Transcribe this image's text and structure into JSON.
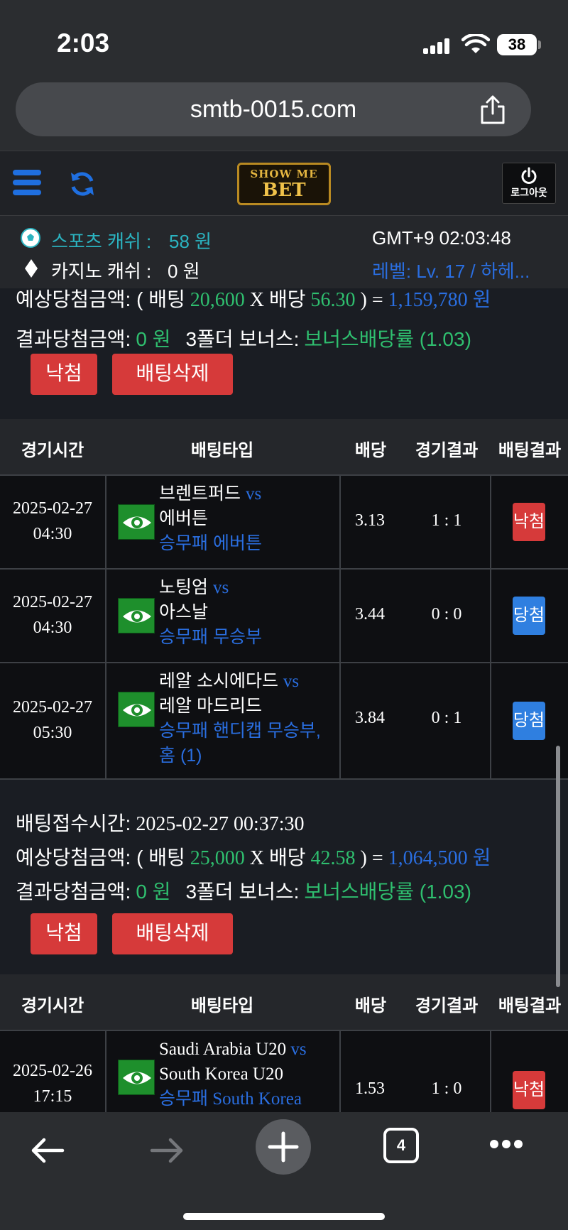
{
  "status_bar": {
    "time": "2:03",
    "battery": "38"
  },
  "browser": {
    "url": "smtb-0015.com",
    "open_tabs": "4"
  },
  "header": {
    "logo_top": "SHOW ME",
    "logo_bottom": "BET",
    "logout_label": "로그아웃"
  },
  "info": {
    "sports_label": "스포츠 캐쉬 :",
    "sports_value": "58 원",
    "casino_label": "카지노 캐쉬 :",
    "casino_value": "0 원",
    "gmt_time": "GMT+9 02:03:48",
    "level": "레벨: Lv. 17 / 하헤..."
  },
  "table_headers": {
    "time": "경기시간",
    "bet_type": "배팅타입",
    "odds": "배당",
    "result": "경기결과",
    "bet_result": "배팅결과"
  },
  "labels": {
    "received_time": "배팅접수시간:",
    "expected": "예상당첨금액: ( 배팅",
    "x_odds": "X 배당",
    "equals": ") =",
    "won": "원",
    "result_amount": "결과당첨금액:",
    "bonus": "3폴더 보너스:",
    "bonus_rate": "보너스배당률 (1.03)",
    "lose_button": "낙첨",
    "delete_button": "배팅삭제",
    "vs": "vs"
  },
  "bet_slips": [
    {
      "received_time": "",
      "stake": "20,600",
      "total_odds": "56.30",
      "expected_payout": "1,159,780",
      "result_amount": "0 원",
      "matches": [
        {
          "date": "2025-02-27",
          "time": "04:30",
          "home": "브렌트퍼드",
          "away": "에버튼",
          "pick": "승무패 에버튼",
          "odds": "3.13",
          "score": "1 : 1",
          "result": "낙첨"
        },
        {
          "date": "2025-02-27",
          "time": "04:30",
          "home": "노팅엄",
          "away": "아스날",
          "pick": "승무패 무승부",
          "odds": "3.44",
          "score": "0 : 0",
          "result": "당첨"
        },
        {
          "date": "2025-02-27",
          "time": "05:30",
          "home": "레알 소시에다드",
          "away": "레알 마드리드",
          "pick": "승무패 핸디캡 무승부,",
          "pick2": "홈 (1)",
          "odds": "3.84",
          "score": "0 : 1",
          "result": "당첨"
        }
      ]
    },
    {
      "received_time": "2025-02-27 00:37:30",
      "stake": "25,000",
      "total_odds": "42.58",
      "expected_payout": "1,064,500",
      "result_amount": "0 원",
      "matches": [
        {
          "date": "2025-02-26",
          "time": "17:15",
          "home": "Saudi Arabia U20",
          "away": "South Korea U20",
          "pick": "승무패 South Korea",
          "odds": "1.53",
          "score": "1 : 0",
          "result": "낙첨"
        }
      ]
    }
  ],
  "colors": {
    "accent_blue": "#2a6ee0",
    "green": "#2fbf6f",
    "red": "#d63a3a",
    "teal": "#2bb3c0"
  }
}
